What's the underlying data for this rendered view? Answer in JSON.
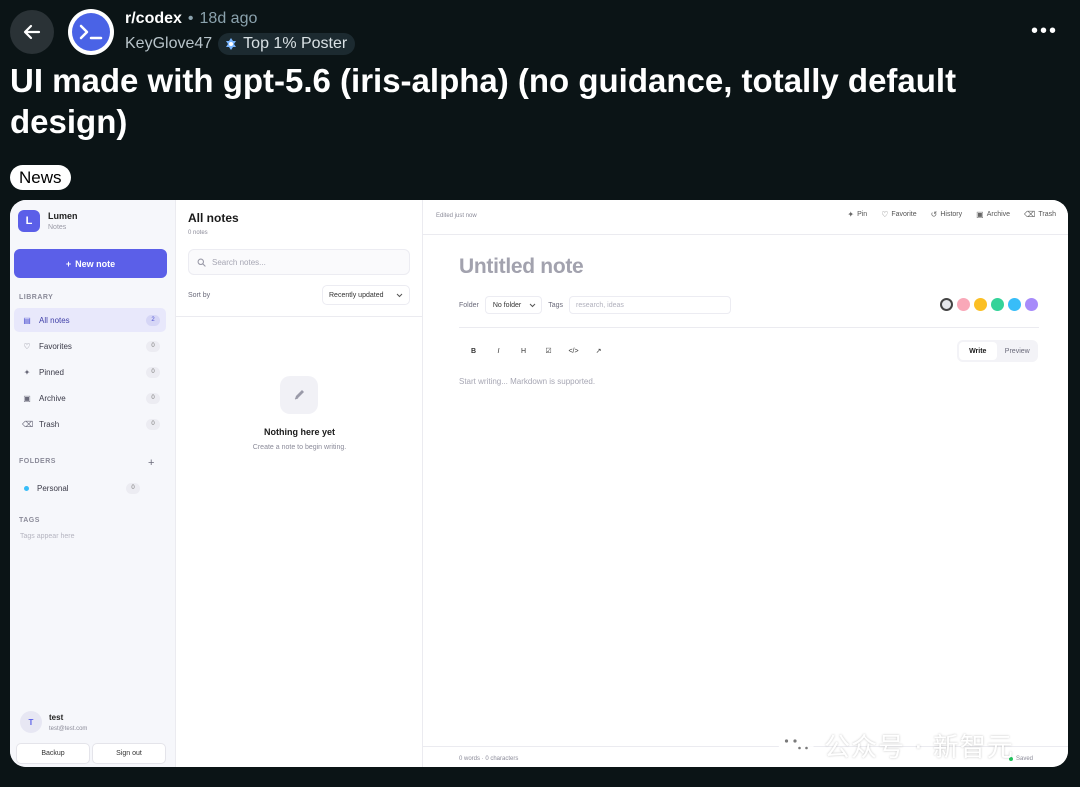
{
  "post": {
    "subreddit": "r/codex",
    "separator": "•",
    "age": "18d ago",
    "author": "KeyGlove47",
    "flair": "Top 1% Poster",
    "title": "UI made with gpt-5.6 (iris-alpha) (no guidance, totally default design)",
    "tag": "News",
    "more": "•••"
  },
  "colors": {
    "background": "#0b1416",
    "accent": "#5b5fe8",
    "subreddit_icon": "#4a63e6"
  },
  "app": {
    "logo_letter": "L",
    "name": "Lumen",
    "subtitle": "Notes",
    "new_note_icon": "+",
    "new_note": "New note",
    "library_label": "LIBRARY",
    "library": [
      {
        "icon": "▤",
        "icon_name": "all-notes-icon",
        "label": "All notes",
        "count": "2"
      },
      {
        "icon": "♡",
        "icon_name": "heart-icon",
        "label": "Favorites",
        "count": "0"
      },
      {
        "icon": "✦",
        "icon_name": "pin-icon",
        "label": "Pinned",
        "count": "0"
      },
      {
        "icon": "▣",
        "icon_name": "archive-icon",
        "label": "Archive",
        "count": "0"
      },
      {
        "icon": "⌫",
        "icon_name": "trash-icon",
        "label": "Trash",
        "count": "0"
      }
    ],
    "folders_label": "FOLDERS",
    "folder_add": "+",
    "folders": [
      {
        "label": "Personal",
        "count": "0",
        "color": "#38bdf8"
      }
    ],
    "tags_label": "TAGS",
    "tags_hint": "Tags appear here",
    "user": {
      "initial": "T",
      "name": "test",
      "email": "test@test.com"
    },
    "backup": "Backup",
    "sign_out": "Sign out"
  },
  "list": {
    "title": "All notes",
    "count": "0 notes",
    "search_placeholder": "Search notes...",
    "sort_label": "Sort by",
    "sort_value": "Recently updated",
    "empty_title": "Nothing here yet",
    "empty_sub": "Create a note to begin writing."
  },
  "editor": {
    "edited": "Edited just now",
    "actions": [
      {
        "icon": "✦",
        "icon_name": "pin-icon",
        "label": "Pin"
      },
      {
        "icon": "♡",
        "icon_name": "heart-icon",
        "label": "Favorite"
      },
      {
        "icon": "↺",
        "icon_name": "history-icon",
        "label": "History"
      },
      {
        "icon": "▣",
        "icon_name": "archive-icon",
        "label": "Archive"
      },
      {
        "icon": "⌫",
        "icon_name": "trash-icon",
        "label": "Trash"
      }
    ],
    "title_placeholder": "Untitled note",
    "folder_label": "Folder",
    "folder_value": "No folder",
    "tags_label": "Tags",
    "tags_placeholder": "research, ideas",
    "swatches": [
      "#e5e7eb",
      "#f9a8b8",
      "#fbbf24",
      "#34d399",
      "#38bdf8",
      "#a78bfa"
    ],
    "toolbar": [
      {
        "label": "B",
        "name": "bold"
      },
      {
        "label": "I",
        "name": "italic"
      },
      {
        "label": "H",
        "name": "heading"
      },
      {
        "label": "☑",
        "name": "checklist"
      },
      {
        "label": "</>",
        "name": "code"
      },
      {
        "label": "↗",
        "name": "link"
      }
    ],
    "write": "Write",
    "preview": "Preview",
    "body_placeholder": "Start writing... Markdown is supported.",
    "word_count": "0 words · 0 characters",
    "saved": "Saved"
  },
  "watermark": "公众号 · 新智元"
}
